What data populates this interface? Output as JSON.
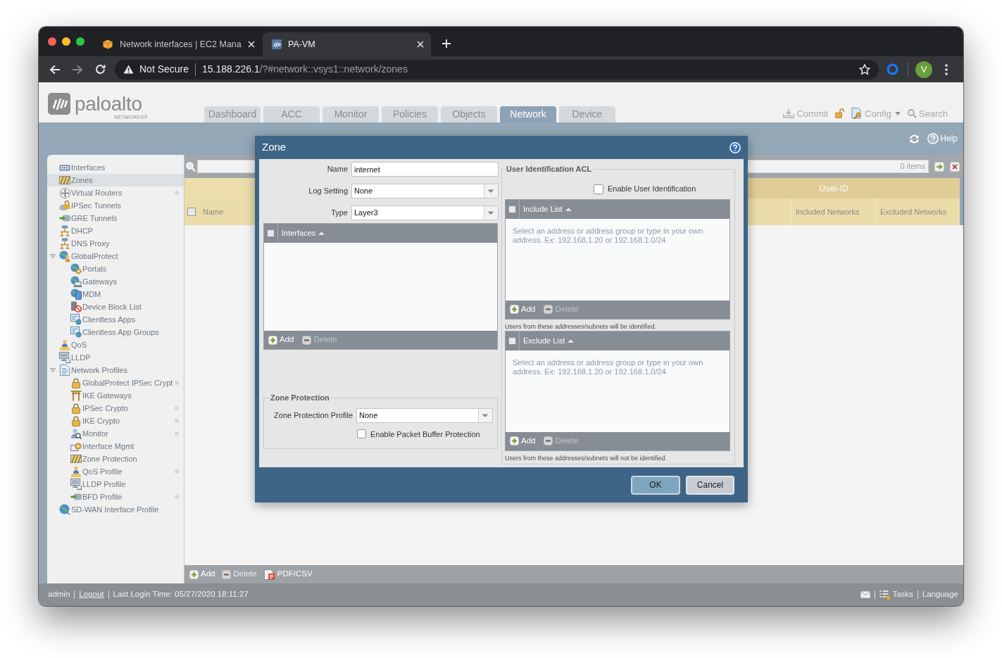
{
  "browser": {
    "tabs": [
      {
        "title": "Network interfaces | EC2 Mana",
        "selected": false
      },
      {
        "title": "PA-VM",
        "selected": true
      }
    ],
    "security_label": "Not Secure",
    "url": {
      "host": "15.188.226.1",
      "path": "/?#network::vsys1::network/zones"
    },
    "profile_initial": "V"
  },
  "app": {
    "logo": {
      "name": "paloalto",
      "tagline": "NETWORKS®"
    },
    "nav_tabs": [
      {
        "label": "Dashboard",
        "selected": false
      },
      {
        "label": "ACC",
        "selected": false
      },
      {
        "label": "Monitor",
        "selected": false
      },
      {
        "label": "Policies",
        "selected": false
      },
      {
        "label": "Objects",
        "selected": false
      },
      {
        "label": "Network",
        "selected": true
      },
      {
        "label": "Device",
        "selected": false
      }
    ],
    "header_actions": [
      {
        "kind": "commit",
        "label": "Commit"
      },
      {
        "kind": "lock"
      },
      {
        "kind": "config",
        "label": "Config"
      },
      {
        "kind": "search",
        "label": "Search"
      }
    ],
    "help_label": "Help",
    "sidebar": {
      "items": [
        {
          "label": "Interfaces",
          "selected": false,
          "dot": false
        },
        {
          "label": "Zones",
          "selected": true,
          "dot": false
        },
        {
          "label": "Virtual Routers",
          "selected": false,
          "dot": true
        },
        {
          "label": "IPSec Tunnels",
          "selected": false,
          "dot": false
        },
        {
          "label": "GRE Tunnels",
          "selected": false,
          "dot": false
        },
        {
          "label": "DHCP",
          "selected": false,
          "dot": false
        },
        {
          "label": "DNS Proxy",
          "selected": false,
          "dot": false
        },
        {
          "label": "GlobalProtect",
          "selected": false,
          "dot": false,
          "expanded": true,
          "children": [
            {
              "label": "Portals",
              "selected": false,
              "dot": false
            },
            {
              "label": "Gateways",
              "selected": false,
              "dot": false
            },
            {
              "label": "MDM",
              "selected": false,
              "dot": false
            },
            {
              "label": "Device Block List",
              "selected": false,
              "dot": false
            },
            {
              "label": "Clientless Apps",
              "selected": false,
              "dot": false
            },
            {
              "label": "Clientless App Groups",
              "selected": false,
              "dot": false
            }
          ]
        },
        {
          "label": "QoS",
          "selected": false,
          "dot": false
        },
        {
          "label": "LLDP",
          "selected": false,
          "dot": false
        },
        {
          "label": "Network Profiles",
          "selected": false,
          "dot": false,
          "expanded": true,
          "children": [
            {
              "label": "GlobalProtect IPSec Crypt",
              "selected": false,
              "dot": true
            },
            {
              "label": "IKE Gateways",
              "selected": false,
              "dot": false
            },
            {
              "label": "IPSec Crypto",
              "selected": false,
              "dot": true
            },
            {
              "label": "IKE Crypto",
              "selected": false,
              "dot": true
            },
            {
              "label": "Monitor",
              "selected": false,
              "dot": true
            },
            {
              "label": "Interface Mgmt",
              "selected": false,
              "dot": false
            },
            {
              "label": "Zone Protection",
              "selected": false,
              "dot": false
            },
            {
              "label": "QoS Profile",
              "selected": false,
              "dot": true
            },
            {
              "label": "LLDP Profile",
              "selected": false,
              "dot": false
            },
            {
              "label": "BFD Profile",
              "selected": false,
              "dot": true
            }
          ]
        },
        {
          "label": "SD-WAN Interface Profile",
          "selected": false,
          "dot": false
        }
      ]
    },
    "table": {
      "filter": {
        "count": "0 items"
      },
      "select_all": {
        "checked": false
      },
      "columns": [
        {
          "label": "Name"
        }
      ],
      "group": {
        "label": "User-ID",
        "columns": [
          {
            "label": "Included Networks"
          },
          {
            "label": "Excluded Networks"
          }
        ]
      }
    },
    "actions": [
      {
        "kind": "add",
        "label": "Add",
        "disabled": false
      },
      {
        "kind": "delete",
        "label": "Delete",
        "disabled": true
      },
      {
        "kind": "export",
        "label": "PDF/CSV",
        "disabled": false
      }
    ],
    "status_bar": {
      "user": "admin",
      "logout": "Logout",
      "last_login": "Last Login Time: 05/27/2020 18:11:27",
      "tasks": "Tasks",
      "language": "Language"
    }
  },
  "dialog": {
    "title": "Zone",
    "fields": [
      {
        "kind": "text",
        "label": "Name",
        "value": "internet"
      },
      {
        "kind": "select",
        "label": "Log Setting",
        "value": "None"
      },
      {
        "kind": "select",
        "label": "Type",
        "value": "Layer3"
      }
    ],
    "interfaces": {
      "title": "Interfaces",
      "checked": false,
      "actions": [
        {
          "kind": "add",
          "label": "Add",
          "disabled": false
        },
        {
          "kind": "delete",
          "label": "Delete",
          "disabled": true
        }
      ]
    },
    "zone_protection": {
      "legend": "Zone Protection",
      "profile": {
        "label": "Zone Protection Profile",
        "value": "None"
      },
      "packet_buffer": {
        "label": "Enable Packet Buffer Protection",
        "checked": false
      }
    },
    "user_identification": {
      "legend": "User Identification ACL",
      "enable": {
        "label": "Enable User Identification",
        "checked": false
      },
      "lists": [
        {
          "title": "Include List",
          "checked": false,
          "empty_text": "Select an address or address group or type in your own address. Ex: 192.168.1.20 or 192.168.1.0/24",
          "actions": [
            {
              "kind": "add",
              "label": "Add",
              "disabled": false
            },
            {
              "kind": "delete",
              "label": "Delete",
              "disabled": true
            }
          ],
          "note": "Users from these addresses/subnets will be identified."
        },
        {
          "title": "Exclude List",
          "checked": false,
          "empty_text": "Select an address or address group or type in your own address. Ex: 192.168.1.20 or 192.168.1.0/24",
          "actions": [
            {
              "kind": "add",
              "label": "Add",
              "disabled": false
            },
            {
              "kind": "delete",
              "label": "Delete",
              "disabled": true
            }
          ],
          "note": "Users from these addresses/subnets will not be identified."
        }
      ]
    },
    "buttons": [
      {
        "kind": "primary",
        "label": "OK"
      },
      {
        "kind": "secondary",
        "label": "Cancel"
      }
    ]
  }
}
